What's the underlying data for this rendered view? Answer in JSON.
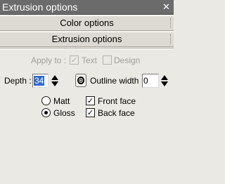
{
  "window": {
    "title": "Extrusion options",
    "close_glyph": "✕",
    "close_icon": "close-icon"
  },
  "sections": {
    "color_options": "Color options",
    "extrusion_options": "Extrusion options"
  },
  "apply_to": {
    "label": "Apply to :",
    "text_label": "Text",
    "text_checked": true,
    "design_label": "Design",
    "design_checked": false,
    "check_glyph": "✓"
  },
  "depth": {
    "label": "Depth :",
    "value": "34"
  },
  "outline": {
    "icon": "outline-ring-icon",
    "label": "Outline width :",
    "value": "0"
  },
  "finish": {
    "matt_label": "Matt",
    "gloss_label": "Gloss",
    "selected": "Gloss"
  },
  "faces": {
    "front_label": "Front face",
    "front_checked": true,
    "back_label": "Back face",
    "back_checked": true,
    "check_glyph": "✓"
  },
  "colors": {
    "titlebar": "#6b6b6b",
    "panel_bg": "#ebe9e3",
    "selection": "#316ac5",
    "disabled_text": "#a09e98"
  }
}
